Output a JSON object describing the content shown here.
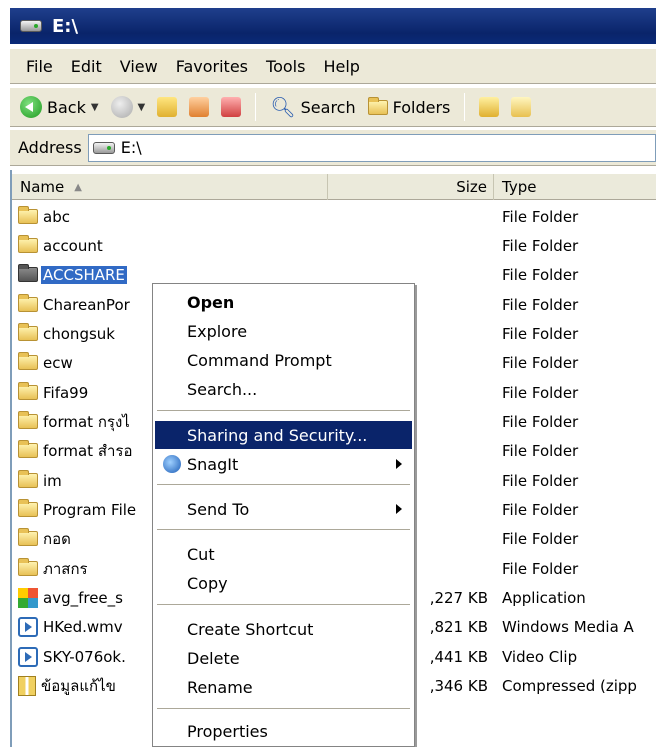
{
  "window": {
    "title": "E:\\"
  },
  "menu": [
    "File",
    "Edit",
    "View",
    "Favorites",
    "Tools",
    "Help"
  ],
  "toolbar": {
    "back": "Back",
    "search": "Search",
    "folders": "Folders"
  },
  "address": {
    "label": "Address",
    "value": "E:\\"
  },
  "columns": {
    "name": "Name",
    "size": "Size",
    "type": "Type"
  },
  "files": [
    {
      "name": "abc",
      "size": "",
      "type": "File Folder",
      "icon": "folder"
    },
    {
      "name": "account",
      "size": "",
      "type": "File Folder",
      "icon": "folder"
    },
    {
      "name": "ACCSHARE",
      "size": "",
      "type": "File Folder",
      "icon": "folder-shared",
      "selected": true
    },
    {
      "name": "ChareanPor",
      "size": "",
      "type": "File Folder",
      "icon": "folder"
    },
    {
      "name": "chongsuk",
      "size": "",
      "type": "File Folder",
      "icon": "folder"
    },
    {
      "name": "ecw",
      "size": "",
      "type": "File Folder",
      "icon": "folder"
    },
    {
      "name": "Fifa99",
      "size": "",
      "type": "File Folder",
      "icon": "folder"
    },
    {
      "name": "format กรุงไ",
      "size": "",
      "type": "File Folder",
      "icon": "folder"
    },
    {
      "name": "format สำรอ",
      "size": "",
      "type": "File Folder",
      "icon": "folder"
    },
    {
      "name": "im",
      "size": "",
      "type": "File Folder",
      "icon": "folder"
    },
    {
      "name": "Program File",
      "size": "",
      "type": "File Folder",
      "icon": "folder"
    },
    {
      "name": "กอด",
      "size": "",
      "type": "File Folder",
      "icon": "folder"
    },
    {
      "name": "ภาสกร",
      "size": "",
      "type": "File Folder",
      "icon": "folder"
    },
    {
      "name": "avg_free_s",
      "size": ",227 KB",
      "type": "Application",
      "icon": "application"
    },
    {
      "name": "HKed.wmv",
      "size": ",821 KB",
      "type": "Windows Media A",
      "icon": "media"
    },
    {
      "name": "SKY-076ok.",
      "size": ",441 KB",
      "type": "Video Clip",
      "icon": "media"
    },
    {
      "name": "ข้อมูลแก้ไข",
      "size": ",346 KB",
      "type": "Compressed (zipp",
      "icon": "zip"
    }
  ],
  "context_menu": {
    "open": "Open",
    "explore": "Explore",
    "command_prompt": "Command Prompt",
    "search": "Search...",
    "sharing": "Sharing and Security...",
    "snagit": "SnagIt",
    "send_to": "Send To",
    "cut": "Cut",
    "copy": "Copy",
    "create_shortcut": "Create Shortcut",
    "delete": "Delete",
    "rename": "Rename",
    "properties": "Properties"
  },
  "colors": {
    "title": "#0a246a",
    "selection": "#316ac5",
    "menu_highlight": "#0a246a",
    "chrome": "#ece9d8"
  }
}
